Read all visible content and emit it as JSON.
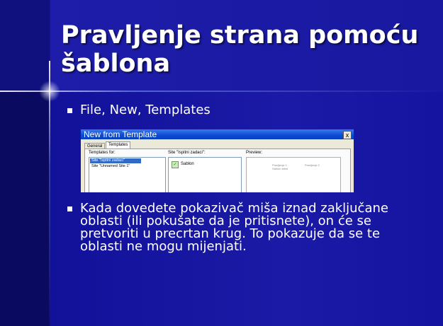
{
  "slide": {
    "title": "Pravljenje strana pomoću šablona",
    "bullets": [
      "File, New, Templates",
      "Kada dovedete pokazivač miša iznad zaključane oblasti (ili pokušate da je pritisnete), on će se pretvoriti u precrtan krug. To pokazuje da se te oblasti ne mogu mijenjati."
    ]
  },
  "dialog": {
    "title": "New from Template",
    "close_glyph": "x",
    "tabs": [
      "General",
      "Templates"
    ],
    "templates_for_label": "Templates for:",
    "sites": [
      "Site \"Ispitni zadaci\"",
      "Site \"Unnamed Site 1\""
    ],
    "site_label": "Site \"Ispitni zadaci\":",
    "template_item": "Sablon",
    "preview_label": "Preview:",
    "preview_text": [
      "Pravljenje 1",
      "Sablon tekst",
      "Pravljenje 2"
    ]
  },
  "colors": {
    "background": "#1414a0",
    "text": "#ffffff",
    "dialog_title_bar": "#0a4bd6"
  }
}
